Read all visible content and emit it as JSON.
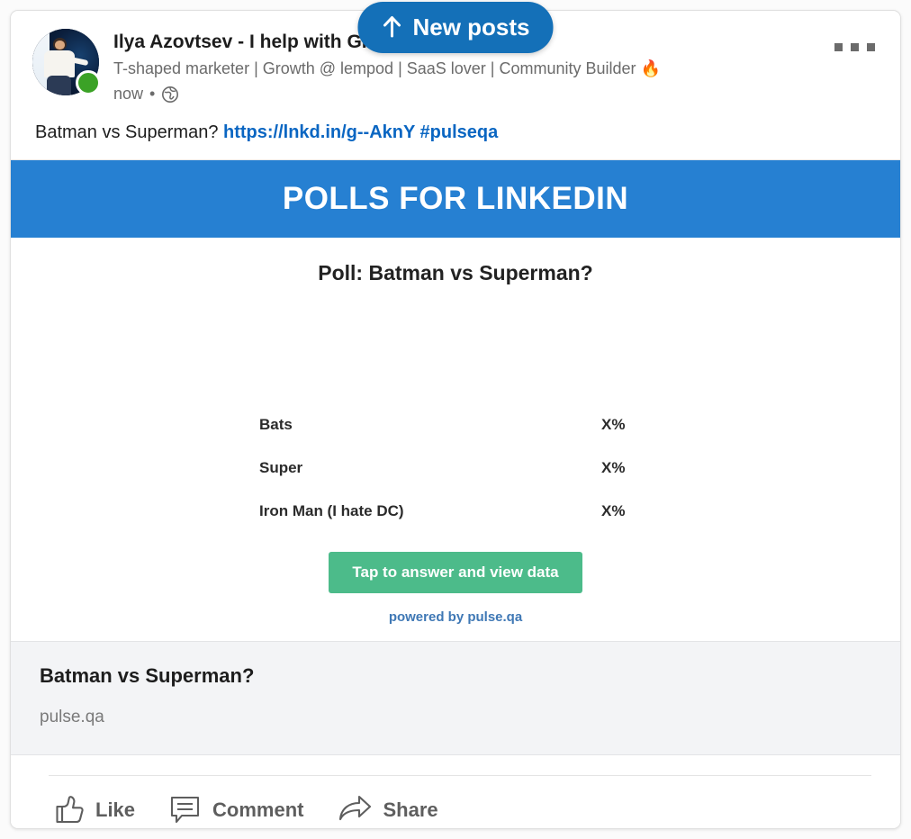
{
  "new_posts_button": {
    "label": "New posts",
    "icon": "arrow-up-icon",
    "background_color": "#1470b8"
  },
  "post": {
    "author": {
      "name": "Ilya Azovtsev - I help with Growth 🚀",
      "headline": "T-shaped marketer | Growth @ lempod | SaaS lover | Community Builder 🔥",
      "timestamp": "now",
      "separator": "•",
      "visibility_icon": "globe-icon",
      "status": "online",
      "status_color": "#3ba226"
    },
    "more_options_icon": "ellipsis-icon",
    "body": {
      "text": "Batman vs Superman? ",
      "link_text": "https://lnkd.in/g--AknY #pulseqa",
      "link_color": "#0a66c2"
    },
    "poll_image": {
      "banner_title": "POLLS FOR LINKEDIN",
      "banner_color": "#2680d2",
      "question": "Poll: Batman vs Superman?",
      "options": [
        {
          "label": "Bats",
          "percent": "X%"
        },
        {
          "label": "Super",
          "percent": "X%"
        },
        {
          "label": "Iron Man (I hate DC)",
          "percent": "X%"
        }
      ],
      "cta_label": "Tap to answer and view data",
      "cta_color": "#4cbb8a",
      "powered_by": "powered by pulse.qa"
    },
    "link_preview": {
      "title": "Batman vs Superman?",
      "domain": "pulse.qa"
    },
    "actions": [
      {
        "label": "Like",
        "icon": "thumbs-up-icon"
      },
      {
        "label": "Comment",
        "icon": "comment-bubble-icon"
      },
      {
        "label": "Share",
        "icon": "share-arrow-icon"
      }
    ]
  }
}
